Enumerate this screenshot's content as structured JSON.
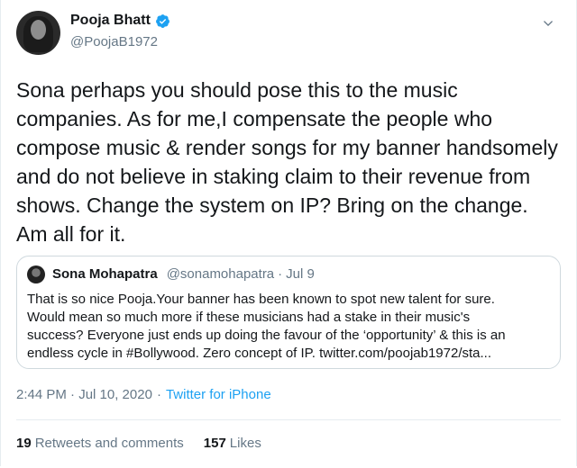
{
  "author": {
    "name": "Pooja Bhatt",
    "handle": "@PoojaB1972"
  },
  "tweet": {
    "text": "Sona perhaps you should pose this to the music companies. As for me,I compensate the people who compose music & render songs for my banner handsomely and do not believe in staking claim to their revenue from shows. Change the system on IP? Bring on the change. Am all for it."
  },
  "quoted": {
    "name": "Sona Mohapatra",
    "handle": "@sonamohapatra",
    "separator": "·",
    "date": "Jul 9",
    "text": "That is so nice Pooja.Your banner has been known to spot new talent for sure.\nWould mean so much more if these musicians had a stake in their music's\nsuccess? Everyone just ends up doing the favour of the ‘opportunity’ & this is an\nendless cycle in #Bollywood. Zero concept of IP. twitter.com/poojab1972/sta..."
  },
  "meta": {
    "time": "2:44 PM · Jul 10, 2020",
    "separator": "·",
    "source": "Twitter for iPhone"
  },
  "stats": {
    "retweets_count": "19",
    "retweets_label": "Retweets and comments",
    "likes_count": "157",
    "likes_label": "Likes"
  },
  "colors": {
    "accent": "#1da1f2",
    "secondary_text": "#657786"
  },
  "icons": {
    "verified": "verified-badge-icon",
    "more": "chevron-down-icon"
  }
}
